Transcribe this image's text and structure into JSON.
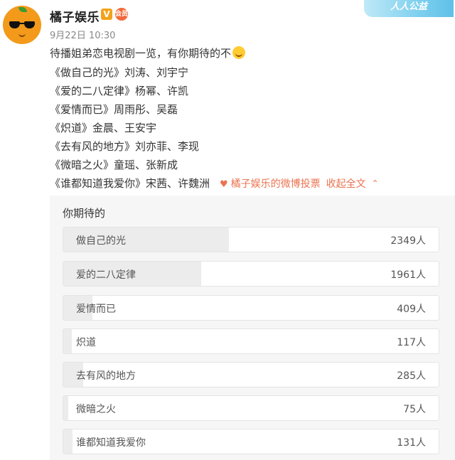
{
  "account": {
    "name": "橘子娱乐",
    "timestamp": "9月22日 10:30",
    "charity_badge": "人人公益",
    "verified_mark": "V",
    "member_mark": "会员"
  },
  "post": {
    "intro": "待播姐弟恋电视剧一览，有你期待的不",
    "lines": [
      "《做自己的光》刘涛、刘宇宁",
      "《爱的二八定律》杨幂、许凯",
      "《爱情而已》周雨彤、吴磊",
      "《炽道》金晨、王安宇",
      "《去有风的地方》刘亦菲、李现",
      "《微暗之火》童瑶、张新成",
      "《谁都知道我爱你》宋茜、许魏洲"
    ],
    "vote_link": "橘子娱乐的微博投票",
    "collapse_link": "收起全文"
  },
  "poll": {
    "title": "你期待的",
    "options": [
      {
        "label": "做自己的光",
        "count": "2349人",
        "votes": 2349
      },
      {
        "label": "爱的二八定律",
        "count": "1961人",
        "votes": 1961
      },
      {
        "label": "爱情而已",
        "count": "409人",
        "votes": 409
      },
      {
        "label": "炽道",
        "count": "117人",
        "votes": 117
      },
      {
        "label": "去有风的地方",
        "count": "285人",
        "votes": 285
      },
      {
        "label": "微暗之火",
        "count": "75人",
        "votes": 75
      },
      {
        "label": "谁都知道我爱你",
        "count": "131人",
        "votes": 131
      }
    ]
  },
  "icons": {
    "vote": "vote-icon",
    "collapse": "chevron-up-icon"
  },
  "colors": {
    "link": "#eb7350",
    "poll_bg": "#f6f6f6",
    "bar_fill": "#ececec"
  }
}
